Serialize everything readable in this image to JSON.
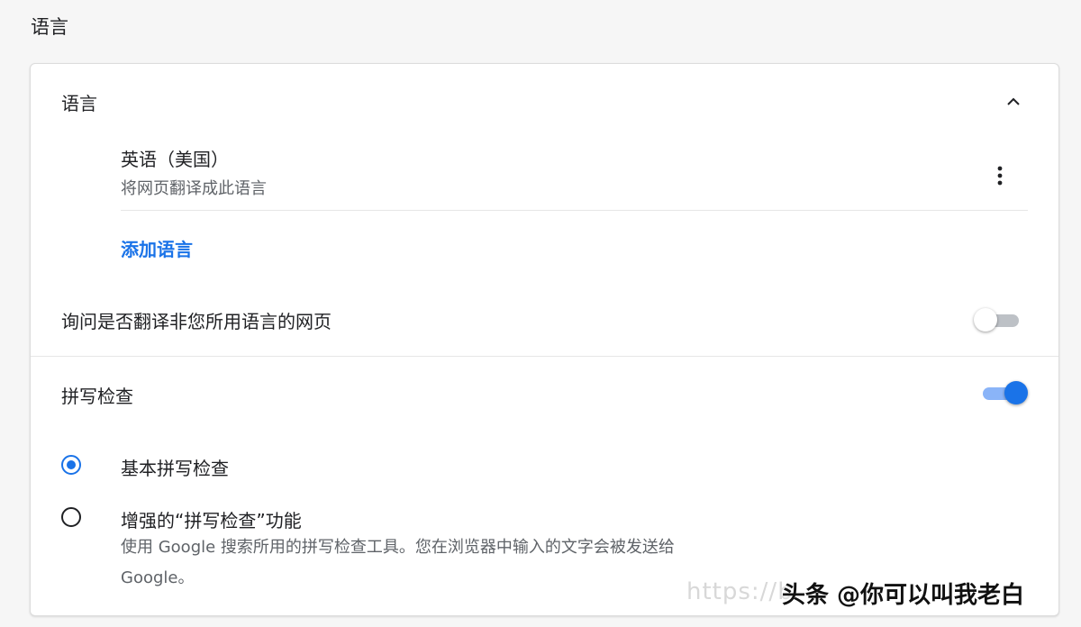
{
  "page": {
    "title": "语言"
  },
  "languages_section": {
    "header_label": "语言",
    "collapse_icon": "chevron-up-icon",
    "items": [
      {
        "name": "英语（美国）",
        "subtitle": "将网页翻译成此语言",
        "menu_icon": "more-vert-icon"
      }
    ],
    "add_language_label": "添加语言",
    "ask_translate": {
      "label": "询问是否翻译非您所用语言的网页",
      "enabled": false
    }
  },
  "spellcheck_section": {
    "label": "拼写检查",
    "enabled": true,
    "options": [
      {
        "label": "基本拼写检查",
        "selected": true,
        "description": ""
      },
      {
        "label": "增强的“拼写检查”功能",
        "selected": false,
        "description_line1": "使用 Google 搜索所用的拼写检查工具。您在浏览器中输入的文字会被发送给",
        "description_line2": "Google。"
      }
    ]
  },
  "overlay": {
    "watermark_text": "https://b",
    "brand_text": "头条 @你可以叫我老白"
  },
  "colors": {
    "accent": "#1a73e8",
    "toggle_on_track": "#8ab4f8",
    "toggle_off_track": "#bdc1c6",
    "secondary_text": "#5f6368"
  }
}
